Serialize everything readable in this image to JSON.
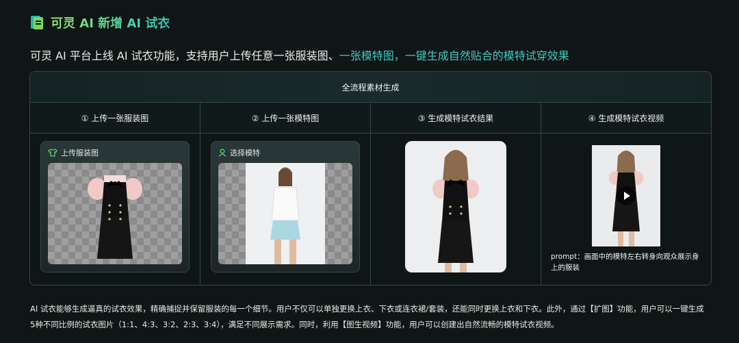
{
  "header": {
    "title": "可灵 AI 新增 AI 试衣",
    "title_icon": "document-icon",
    "subtitle_plain": "可灵 AI 平台上线 AI 试衣功能，支持用户上传任意一张服装图、",
    "subtitle_highlight": "一张模特图，一键生成自然贴合的模特试穿效果"
  },
  "panel": {
    "title": "全流程素材生成",
    "steps": [
      {
        "label": "① 上传一张服装图",
        "card_label": "上传服装图",
        "card_icon": "shirt-icon"
      },
      {
        "label": "② 上传一张模特图",
        "card_label": "选择模特",
        "card_icon": "person-icon"
      },
      {
        "label": "③ 生成模特试衣结果"
      },
      {
        "label": "④ 生成模特试衣视频",
        "prompt": "prompt：画面中的模特左右转身向观众展示身上的服装"
      }
    ]
  },
  "footer": {
    "text": "AI 试衣能够生成逼真的试衣效果，精确捕捉并保留服装的每一个细节。用户不仅可以单独更换上衣、下衣或连衣裙/套装，还能同时更换上衣和下衣。此外，通过【扩图】功能，用户可以一键生成5种不同比例的试衣图片（1:1、4:3、3:2、2:3、3:4），满足不同展示需求。同时，利用【图生视频】功能，用户可以创建出自然流畅的模特试衣视频。"
  },
  "colors": {
    "accent_green": "#8fe36a",
    "accent_teal": "#2cc6c0",
    "border": "#2f4a47",
    "background": "#101515"
  }
}
